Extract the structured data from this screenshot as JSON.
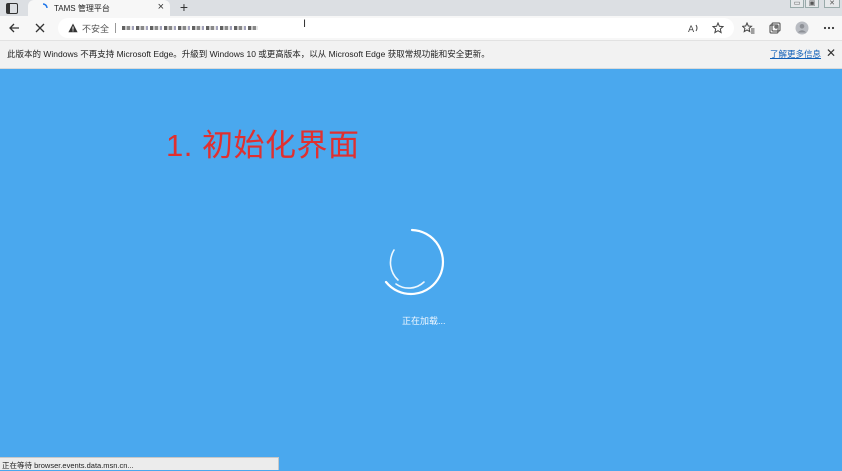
{
  "browser": {
    "tab": {
      "title": "TAMS 管理平台"
    },
    "address": {
      "security_label": "不安全",
      "url": "• ▪︎ ▪︎▪︎ ▪︎ ▪︎▪︎ ▪︎ ▪︎▪︎ ▪︎▪︎ ' ▪︎ ▪︎ ▪︎▪︎▪︎"
    },
    "icons": {
      "tab_actions": "tab-actions-icon",
      "loading": "loading-spinner-icon",
      "tab_close": "close-icon",
      "new_tab": "plus-icon",
      "back": "back-arrow-icon",
      "stop": "stop-icon",
      "warning": "warning-icon",
      "read_aloud": "read-aloud-icon",
      "favorite": "add-favorite-icon",
      "favorites": "favorites-icon",
      "collections": "collections-icon",
      "profile": "profile-icon",
      "more": "more-icon"
    }
  },
  "infobar": {
    "message": "此版本的 Windows 不再支持 Microsoft Edge。升級到 Windows 10 或更高版本，以从 Microsoft Edge 获取常规功能和安全更新。",
    "link_label": "了解更多信息"
  },
  "page": {
    "heading": "1. 初始化界面",
    "loading_text": "正在加载..."
  },
  "status_bar": {
    "text": "正在等待 browser.events.data.msn.cn..."
  },
  "colors": {
    "page_background": "#4aa8ee",
    "heading": "#e03030",
    "spinner": "#ffffff",
    "link": "#0f5fb8"
  }
}
